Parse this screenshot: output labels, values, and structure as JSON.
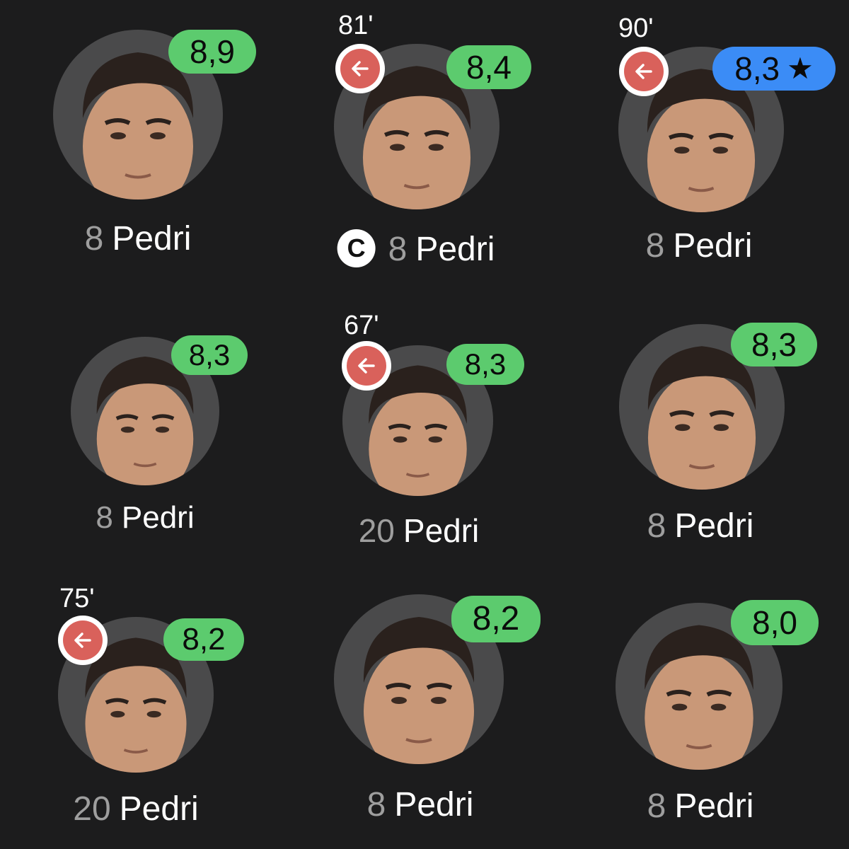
{
  "colors": {
    "background": "#1c1c1d",
    "rating_green": "#5ccb6e",
    "rating_blue": "#3b8cf6",
    "sub_off_red": "#d9615b",
    "avatar_bg": "#4a4a4b"
  },
  "players": [
    {
      "rating": "8,9",
      "number": "8",
      "name": "Pedri",
      "sub_time": "",
      "subbed_off": false,
      "captain": false,
      "player_of_match": false
    },
    {
      "rating": "8,4",
      "number": "8",
      "name": "Pedri",
      "sub_time": "81'",
      "subbed_off": true,
      "captain": true,
      "captain_label": "C",
      "player_of_match": false
    },
    {
      "rating": "8,3",
      "number": "8",
      "name": "Pedri",
      "sub_time": "90'",
      "subbed_off": true,
      "captain": false,
      "player_of_match": true,
      "star": "★"
    },
    {
      "rating": "8,3",
      "number": "8",
      "name": "Pedri",
      "sub_time": "",
      "subbed_off": false,
      "captain": false,
      "player_of_match": false
    },
    {
      "rating": "8,3",
      "number": "20",
      "name": "Pedri",
      "sub_time": "67'",
      "subbed_off": true,
      "captain": false,
      "player_of_match": false
    },
    {
      "rating": "8,3",
      "number": "8",
      "name": "Pedri",
      "sub_time": "",
      "subbed_off": false,
      "captain": false,
      "player_of_match": false
    },
    {
      "rating": "8,2",
      "number": "20",
      "name": "Pedri",
      "sub_time": "75'",
      "subbed_off": true,
      "captain": false,
      "player_of_match": false
    },
    {
      "rating": "8,2",
      "number": "8",
      "name": "Pedri",
      "sub_time": "",
      "subbed_off": false,
      "captain": false,
      "player_of_match": false
    },
    {
      "rating": "8,0",
      "number": "8",
      "name": "Pedri",
      "sub_time": "",
      "subbed_off": false,
      "captain": false,
      "player_of_match": false
    }
  ]
}
